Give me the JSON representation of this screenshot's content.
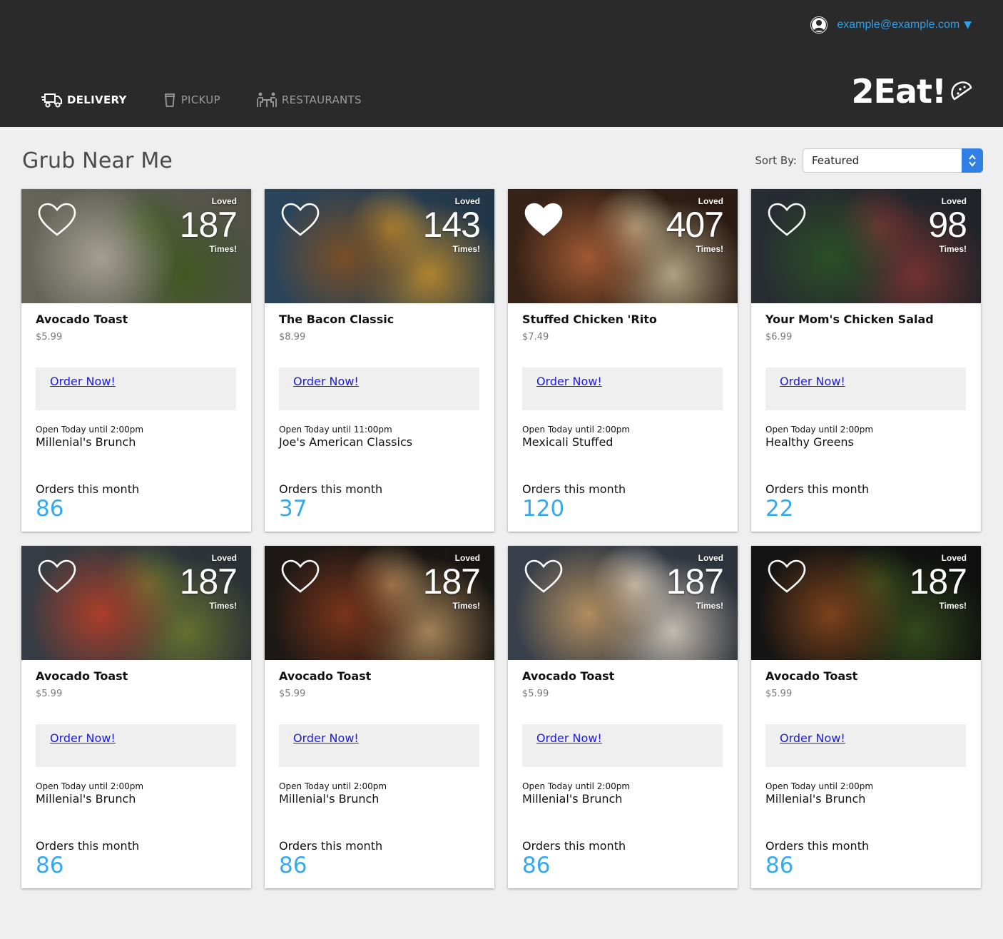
{
  "header": {
    "user_email": "example@example.com",
    "user_caret": "▼",
    "nav": [
      {
        "label": "DELIVERY",
        "icon": "truck-icon",
        "active": true
      },
      {
        "label": "PICKUP",
        "icon": "cup-icon",
        "active": false
      },
      {
        "label": "RESTAURANTS",
        "icon": "dining-table-icon",
        "active": false
      }
    ],
    "logo_text": "2Eat!",
    "logo_icon": "taco-icon"
  },
  "main": {
    "title": "Grub Near Me",
    "sort_label": "Sort By:",
    "sort_value": "Featured",
    "loved_top": "Loved",
    "loved_bottom": "Times!",
    "order_label": "Order Now!",
    "orders_label": "Orders this month",
    "cards": [
      {
        "name": "Avocado Toast",
        "price": "$5.99",
        "loved": "187",
        "favorited": false,
        "hours": "Open Today until 2:00pm",
        "restaurant": "Millenial's Brunch",
        "orders": "86",
        "photo": "avocado-toast-photo",
        "colors": [
          "#6b6b5e",
          "#b9b4a6",
          "#4f6b2a"
        ]
      },
      {
        "name": "The Bacon Classic",
        "price": "$8.99",
        "loved": "143",
        "favorited": false,
        "hours": "Open Today until 11:00pm",
        "restaurant": "Joe's American Classics",
        "orders": "37",
        "photo": "burger-fries-photo",
        "colors": [
          "#2d4860",
          "#8a5a2c",
          "#d9a23a"
        ]
      },
      {
        "name": "Stuffed Chicken 'Rito",
        "price": "$7.49",
        "loved": "407",
        "favorited": true,
        "hours": "Open Today until 2:00pm",
        "restaurant": "Mexicali Stuffed",
        "orders": "120",
        "photo": "burrito-photo",
        "colors": [
          "#3a2418",
          "#b5653a",
          "#d8c7a0"
        ]
      },
      {
        "name": "Your Mom's Chicken Salad",
        "price": "$6.99",
        "loved": "98",
        "favorited": false,
        "hours": "Open Today until 2:00pm",
        "restaurant": "Healthy Greens",
        "orders": "22",
        "photo": "chicken-salad-photo",
        "colors": [
          "#2b2f36",
          "#2f5a2a",
          "#8d3d3b"
        ]
      },
      {
        "name": "Avocado Toast",
        "price": "$5.99",
        "loved": "187",
        "favorited": false,
        "hours": "Open Today until 2:00pm",
        "restaurant": "Millenial's Brunch",
        "orders": "86",
        "photo": "salmon-salad-photo",
        "colors": [
          "#3a4048",
          "#c4462f",
          "#7d8a3a"
        ]
      },
      {
        "name": "Avocado Toast",
        "price": "$5.99",
        "loved": "187",
        "favorited": false,
        "hours": "Open Today until 2:00pm",
        "restaurant": "Millenial's Brunch",
        "orders": "86",
        "photo": "indian-food-photo",
        "colors": [
          "#1f1a17",
          "#8b3b1e",
          "#c9a06b"
        ]
      },
      {
        "name": "Avocado Toast",
        "price": "$5.99",
        "loved": "187",
        "favorited": false,
        "hours": "Open Today until 2:00pm",
        "restaurant": "Millenial's Brunch",
        "orders": "86",
        "photo": "pancakes-photo",
        "colors": [
          "#3c4450",
          "#caa06b",
          "#f1e7d8"
        ]
      },
      {
        "name": "Avocado Toast",
        "price": "$5.99",
        "loved": "187",
        "favorited": false,
        "hours": "Open Today until 2:00pm",
        "restaurant": "Millenial's Brunch",
        "orders": "86",
        "photo": "stir-fry-photo",
        "colors": [
          "#151515",
          "#8e4b1f",
          "#3f5a22"
        ]
      }
    ]
  },
  "colors": {
    "header_bg": "#2a2a2b",
    "accent_blue": "#36a9ef",
    "link_blue": "#1a1ae6",
    "page_bg": "#efefef"
  }
}
